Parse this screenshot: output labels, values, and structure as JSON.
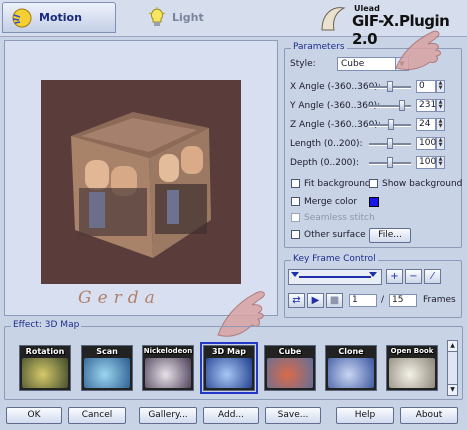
{
  "tabs": [
    {
      "label": "Motion",
      "icon": "motion-icon",
      "active": true
    },
    {
      "label": "Light",
      "icon": "lightbulb-icon",
      "active": false
    }
  ],
  "brand": {
    "vendor": "Ulead",
    "product": "GIF-X.Plugin 2.0"
  },
  "preview": {
    "signature": "Gerda",
    "background": "#5a3d3a"
  },
  "parameters": {
    "title": "Parameters",
    "style_label": "Style:",
    "style_value": "Cube",
    "sliders": [
      {
        "label": "X Angle (-360..360):",
        "value": "0",
        "fraction": 0.5
      },
      {
        "label": "Y Angle (-360..360):",
        "value": "231",
        "fraction": 0.82
      },
      {
        "label": "Z Angle (-360..360):",
        "value": "24",
        "fraction": 0.53
      },
      {
        "label": "Length (0..200):",
        "value": "100",
        "fraction": 0.5
      },
      {
        "label": "Depth (0..200):",
        "value": "100",
        "fraction": 0.5
      }
    ],
    "fit_background": "Fit background",
    "show_background": "Show background",
    "merge_color": "Merge color",
    "merge_color_value": "#1616e8",
    "seamless_stitch": "Seamless stitch",
    "other_surface": "Other surface",
    "file_button": "File..."
  },
  "keyframe": {
    "title": "Key Frame Control",
    "current_frame": "1",
    "separator": "/",
    "total_frames": "15",
    "frames_label": "Frames"
  },
  "effects": {
    "title": "Effect: 3D Map",
    "items": [
      {
        "label": "Rotation",
        "colors": [
          "#d6c96a",
          "#3f4a2c"
        ]
      },
      {
        "label": "Scan",
        "colors": [
          "#9ad6f0",
          "#2c5b8e"
        ]
      },
      {
        "label": "Nickelodeon",
        "colors": [
          "#e7e2e8",
          "#4a3c56"
        ]
      },
      {
        "label": "3D Map",
        "colors": [
          "#a8c7f5",
          "#1e3c8c"
        ],
        "selected": true
      },
      {
        "label": "Cube",
        "colors": [
          "#d96b4a",
          "#5f6f9a"
        ]
      },
      {
        "label": "Clone",
        "colors": [
          "#c9d6f2",
          "#3a55a0"
        ]
      },
      {
        "label": "Open Book",
        "colors": [
          "#f4f1e7",
          "#8a8578"
        ]
      }
    ]
  },
  "buttons": {
    "ok": "OK",
    "cancel": "Cancel",
    "gallery": "Gallery...",
    "add": "Add...",
    "save": "Save...",
    "help": "Help",
    "about": "About"
  }
}
